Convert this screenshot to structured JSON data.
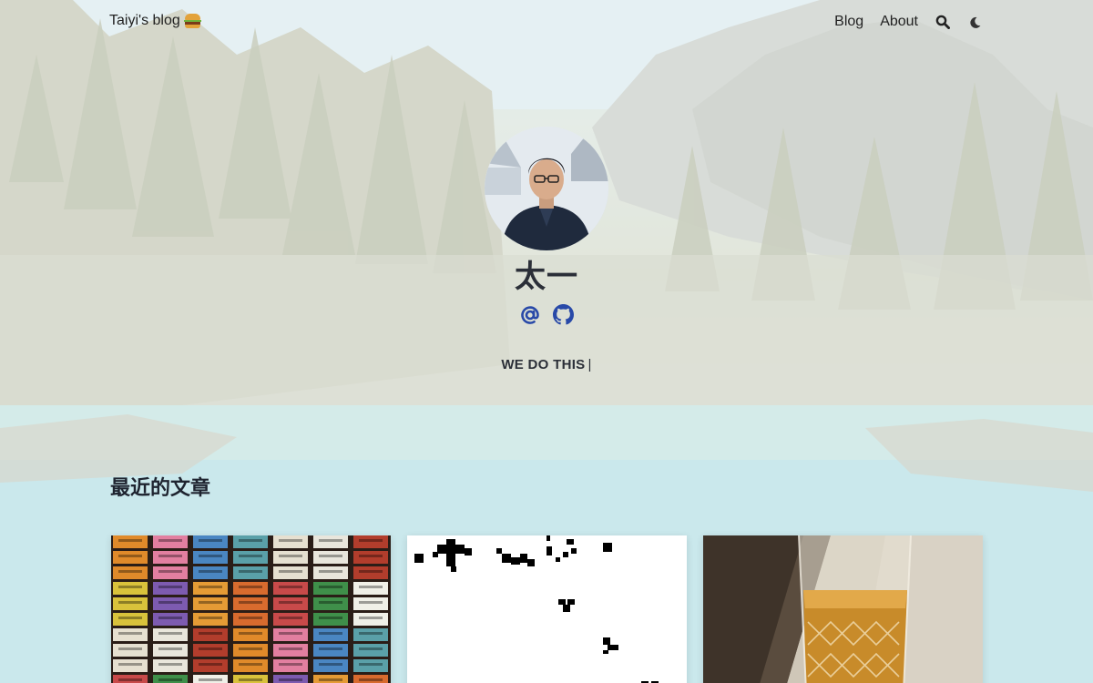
{
  "header": {
    "brand": "Taiyi's blog",
    "brand_icon": "hamburger-emoji-icon",
    "nav": [
      {
        "label": "Blog"
      },
      {
        "label": "About"
      }
    ],
    "search_icon": "search-icon",
    "theme_icon": "moon-icon"
  },
  "profile": {
    "name": "太一",
    "subtitle": "WE DO THIS",
    "caret": "|",
    "social_icons": [
      "email-at-icon",
      "github-icon"
    ],
    "accent_color": "#2849a8"
  },
  "recent": {
    "title": "最近的文章",
    "cards": [
      {
        "image": "colorful-boxes-photo"
      },
      {
        "image": "pixel-pattern-image"
      },
      {
        "image": "whiskey-glass-photo"
      }
    ]
  }
}
